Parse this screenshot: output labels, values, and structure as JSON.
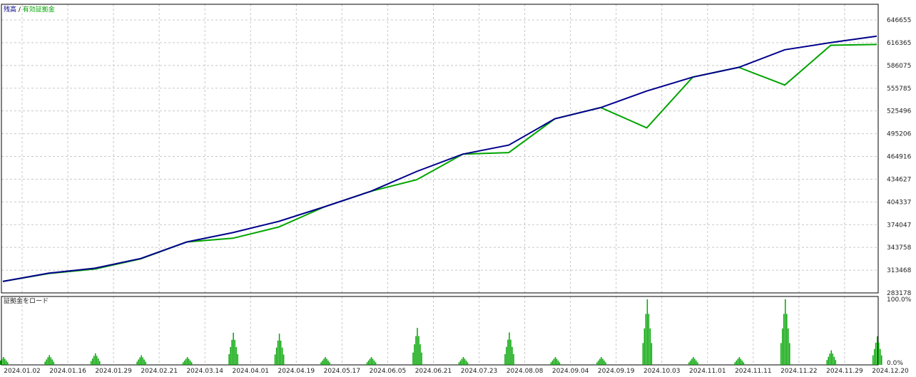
{
  "top_panel": {
    "legend_balance": "残高",
    "legend_sep": " / ",
    "legend_equity": "有効証拠金",
    "colors": {
      "balance": "#00008b",
      "equity": "#00a400",
      "grid": "#c8c8c8",
      "frame": "#000000"
    }
  },
  "bottom_panel": {
    "title": "証拠金をロード",
    "color": "#00a400"
  },
  "chart_data": [
    {
      "type": "line",
      "series": [
        {
          "name": "残高",
          "x": [
            "2024.01.02",
            "2024.01.16",
            "2024.01.29",
            "2024.02.21",
            "2024.03.14",
            "2024.04.01",
            "2024.04.19",
            "2024.05.17",
            "2024.06.05",
            "2024.06.21",
            "2024.07.23",
            "2024.08.08",
            "2024.09.04",
            "2024.09.19",
            "2024.10.03",
            "2024.11.01",
            "2024.11.11",
            "2024.11.22",
            "2024.11.29",
            "2024.12.20"
          ],
          "values": [
            298500,
            309500,
            316000,
            329000,
            351000,
            363500,
            378500,
            398000,
            418500,
            445000,
            468000,
            480000,
            515000,
            530000,
            552000,
            570500,
            583500,
            607000,
            616500,
            625000
          ]
        },
        {
          "name": "有効証拠金",
          "x": [
            "2024.01.02",
            "2024.01.16",
            "2024.01.29",
            "2024.02.21",
            "2024.03.14",
            "2024.04.01",
            "2024.04.19",
            "2024.05.17",
            "2024.06.05",
            "2024.06.21",
            "2024.07.23",
            "2024.08.08",
            "2024.09.04",
            "2024.09.19",
            "2024.10.03",
            "2024.11.01",
            "2024.11.11",
            "2024.11.22",
            "2024.11.29",
            "2024.12.20"
          ],
          "values": [
            298500,
            309000,
            315000,
            328500,
            351000,
            356000,
            371000,
            398000,
            418500,
            434000,
            468000,
            470000,
            515000,
            530000,
            503000,
            570500,
            583500,
            560000,
            613000,
            614000
          ]
        }
      ],
      "y_ticks": [
        "646655",
        "616365",
        "586075",
        "555785",
        "525496",
        "495206",
        "464916",
        "434627",
        "404337",
        "374047",
        "343758",
        "313468",
        "283178"
      ],
      "ylim": [
        283178,
        646655
      ],
      "grid": true
    },
    {
      "type": "bar",
      "title": "証拠金をロード",
      "y_ticks": [
        "100.0%",
        "0.0%"
      ],
      "ylim": [
        0,
        100
      ],
      "x_ticks": [
        "2024.01.02",
        "2024.01.16",
        "2024.01.29",
        "2024.02.21",
        "2024.03.14",
        "2024.04.01",
        "2024.04.19",
        "2024.05.17",
        "2024.06.05",
        "2024.06.21",
        "2024.07.23",
        "2024.08.08",
        "2024.09.04",
        "2024.09.19",
        "2024.10.03",
        "2024.11.01",
        "2024.11.11",
        "2024.11.22",
        "2024.11.29",
        "2024.12.20"
      ]
    }
  ]
}
